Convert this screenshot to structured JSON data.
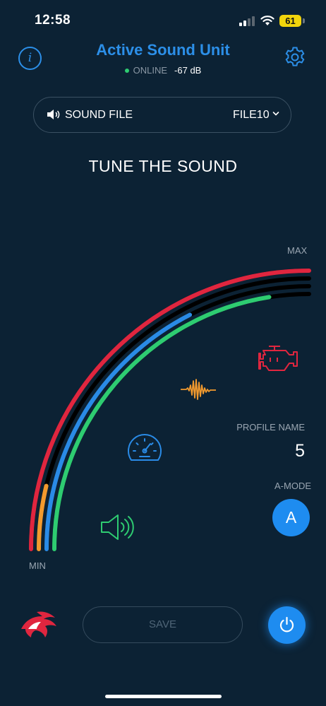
{
  "status_bar": {
    "time": "12:58",
    "battery": "61",
    "icons": [
      "cellular-signal-icon",
      "wifi-icon",
      "battery-icon"
    ]
  },
  "header": {
    "title": "Active Sound Unit",
    "status": "ONLINE",
    "level": "-67 dB",
    "icons": [
      "info-icon",
      "gear-icon"
    ]
  },
  "sound_file": {
    "label": "SOUND FILE",
    "value": "FILE10",
    "icons": [
      "speaker-icon",
      "chevron-down-icon"
    ]
  },
  "tune": {
    "title": "TUNE THE SOUND",
    "max_label": "MAX",
    "min_label": "MIN",
    "sliders": [
      {
        "name": "engine",
        "color": "#e0263f",
        "level": 1.0,
        "icon": "engine-icon"
      },
      {
        "name": "sound-wave",
        "color": "#f29a2e",
        "level": 0.15,
        "icon": "sound-wave-icon"
      },
      {
        "name": "speed",
        "color": "#2a8be6",
        "level": 0.7,
        "icon": "speedometer-icon"
      },
      {
        "name": "volume",
        "color": "#2ecc71",
        "level": 0.9,
        "icon": "volume-icon"
      }
    ],
    "track_color": "#000000"
  },
  "profile": {
    "label": "PROFILE NAME",
    "value": "5"
  },
  "amode": {
    "label": "A-MODE",
    "button": "A"
  },
  "footer": {
    "save": "SAVE",
    "icons": [
      "brand-logo-icon",
      "power-icon"
    ]
  },
  "colors": {
    "background": "#0c2234",
    "accent": "#1e8cf0",
    "online": "#2ecc71"
  }
}
